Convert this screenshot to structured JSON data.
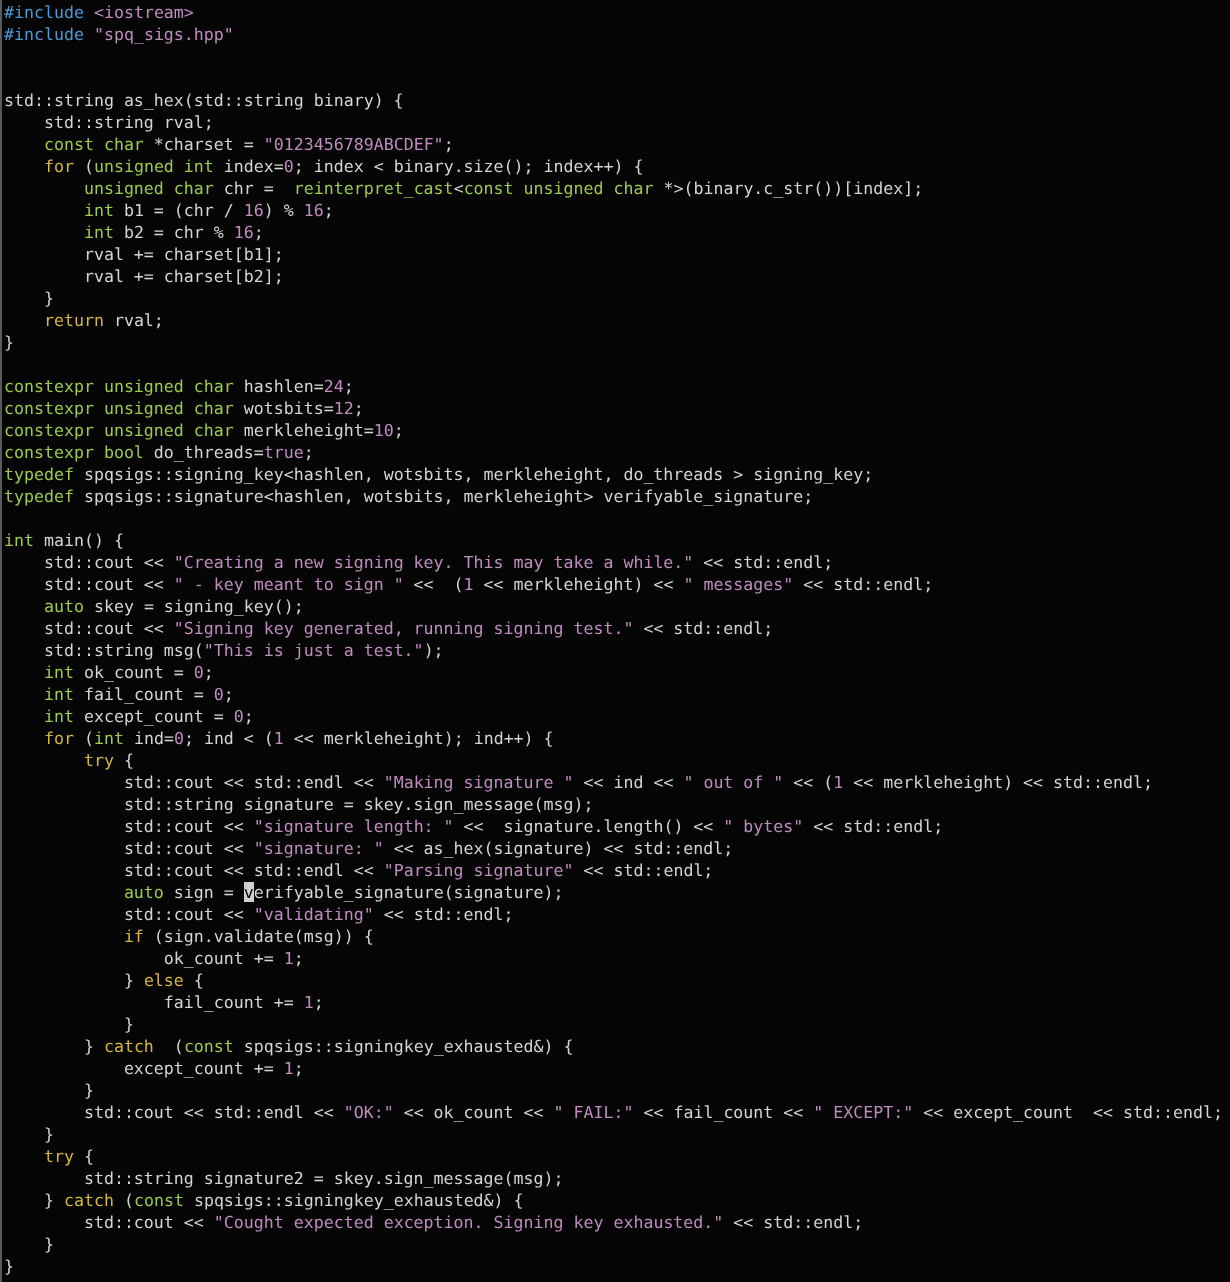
{
  "editor": {
    "lines": [
      {
        "kind": "code",
        "tokens": [
          {
            "kind": "preproc",
            "text": "#include "
          },
          {
            "kind": "string",
            "text": "<iostream>"
          }
        ]
      },
      {
        "kind": "code",
        "tokens": [
          {
            "kind": "preproc",
            "text": "#include "
          },
          {
            "kind": "string",
            "text": "\"spq_sigs.hpp\""
          }
        ]
      },
      {
        "kind": "blank"
      },
      {
        "kind": "blank"
      },
      {
        "kind": "code",
        "tokens": [
          {
            "kind": "plain",
            "text": "std::string as_hex(std::string binary) {"
          }
        ]
      },
      {
        "kind": "code",
        "tokens": [
          {
            "kind": "plain",
            "text": "    std::string rval;"
          }
        ]
      },
      {
        "kind": "code",
        "tokens": [
          {
            "kind": "type",
            "text": "    const char"
          },
          {
            "kind": "plain",
            "text": " *charset = "
          },
          {
            "kind": "string",
            "text": "\"0123456789ABCDEF\""
          },
          {
            "kind": "plain",
            "text": ";"
          }
        ]
      },
      {
        "kind": "code",
        "tokens": [
          {
            "kind": "control",
            "text": "    for"
          },
          {
            "kind": "plain",
            "text": " ("
          },
          {
            "kind": "type",
            "text": "unsigned int"
          },
          {
            "kind": "plain",
            "text": " index="
          },
          {
            "kind": "literal",
            "text": "0"
          },
          {
            "kind": "plain",
            "text": "; index < binary.size(); index++) {"
          }
        ]
      },
      {
        "kind": "code",
        "tokens": [
          {
            "kind": "type",
            "text": "        unsigned char"
          },
          {
            "kind": "plain",
            "text": " chr =  "
          },
          {
            "kind": "type",
            "text": "reinterpret_cast"
          },
          {
            "kind": "plain",
            "text": "<"
          },
          {
            "kind": "type",
            "text": "const unsigned char"
          },
          {
            "kind": "plain",
            "text": " *>(binary.c_str())[index];"
          }
        ]
      },
      {
        "kind": "code",
        "tokens": [
          {
            "kind": "type",
            "text": "        int"
          },
          {
            "kind": "plain",
            "text": " b1 = (chr / "
          },
          {
            "kind": "literal",
            "text": "16"
          },
          {
            "kind": "plain",
            "text": ") % "
          },
          {
            "kind": "literal",
            "text": "16"
          },
          {
            "kind": "plain",
            "text": ";"
          }
        ]
      },
      {
        "kind": "code",
        "tokens": [
          {
            "kind": "type",
            "text": "        int"
          },
          {
            "kind": "plain",
            "text": " b2 = chr % "
          },
          {
            "kind": "literal",
            "text": "16"
          },
          {
            "kind": "plain",
            "text": ";"
          }
        ]
      },
      {
        "kind": "code",
        "tokens": [
          {
            "kind": "plain",
            "text": "        rval += charset[b1];"
          }
        ]
      },
      {
        "kind": "code",
        "tokens": [
          {
            "kind": "plain",
            "text": "        rval += charset[b2];"
          }
        ]
      },
      {
        "kind": "code",
        "tokens": [
          {
            "kind": "plain",
            "text": "    }"
          }
        ]
      },
      {
        "kind": "code",
        "tokens": [
          {
            "kind": "control",
            "text": "    return"
          },
          {
            "kind": "plain",
            "text": " rval;"
          }
        ]
      },
      {
        "kind": "code",
        "tokens": [
          {
            "kind": "plain",
            "text": "}"
          }
        ]
      },
      {
        "kind": "blank"
      },
      {
        "kind": "code",
        "tokens": [
          {
            "kind": "type",
            "text": "constexpr unsigned char"
          },
          {
            "kind": "plain",
            "text": " hashlen="
          },
          {
            "kind": "literal",
            "text": "24"
          },
          {
            "kind": "plain",
            "text": ";"
          }
        ]
      },
      {
        "kind": "code",
        "tokens": [
          {
            "kind": "type",
            "text": "constexpr unsigned char"
          },
          {
            "kind": "plain",
            "text": " wotsbits="
          },
          {
            "kind": "literal",
            "text": "12"
          },
          {
            "kind": "plain",
            "text": ";"
          }
        ]
      },
      {
        "kind": "code",
        "tokens": [
          {
            "kind": "type",
            "text": "constexpr unsigned char"
          },
          {
            "kind": "plain",
            "text": " merkleheight="
          },
          {
            "kind": "literal",
            "text": "10"
          },
          {
            "kind": "plain",
            "text": ";"
          }
        ]
      },
      {
        "kind": "code",
        "tokens": [
          {
            "kind": "type",
            "text": "constexpr bool"
          },
          {
            "kind": "plain",
            "text": " do_threads="
          },
          {
            "kind": "literal",
            "text": "true"
          },
          {
            "kind": "plain",
            "text": ";"
          }
        ]
      },
      {
        "kind": "code",
        "tokens": [
          {
            "kind": "type",
            "text": "typedef"
          },
          {
            "kind": "plain",
            "text": " spqsigs::signing_key<hashlen, wotsbits, merkleheight, do_threads > signing_key;"
          }
        ]
      },
      {
        "kind": "code",
        "tokens": [
          {
            "kind": "type",
            "text": "typedef"
          },
          {
            "kind": "plain",
            "text": " spqsigs::signature<hashlen, wotsbits, merkleheight> verifyable_signature;"
          }
        ]
      },
      {
        "kind": "blank"
      },
      {
        "kind": "code",
        "tokens": [
          {
            "kind": "type",
            "text": "int"
          },
          {
            "kind": "plain",
            "text": " main() {"
          }
        ]
      },
      {
        "kind": "code",
        "tokens": [
          {
            "kind": "plain",
            "text": "    std::cout << "
          },
          {
            "kind": "string",
            "text": "\"Creating a new signing key. This may take a while.\""
          },
          {
            "kind": "plain",
            "text": " << std::endl;"
          }
        ]
      },
      {
        "kind": "code",
        "tokens": [
          {
            "kind": "plain",
            "text": "    std::cout << "
          },
          {
            "kind": "string",
            "text": "\" - key meant to sign \""
          },
          {
            "kind": "plain",
            "text": " <<  ("
          },
          {
            "kind": "literal",
            "text": "1"
          },
          {
            "kind": "plain",
            "text": " << merkleheight) << "
          },
          {
            "kind": "string",
            "text": "\" messages\""
          },
          {
            "kind": "plain",
            "text": " << std::endl;"
          }
        ]
      },
      {
        "kind": "code",
        "tokens": [
          {
            "kind": "type",
            "text": "    auto"
          },
          {
            "kind": "plain",
            "text": " skey = signing_key();"
          }
        ]
      },
      {
        "kind": "code",
        "tokens": [
          {
            "kind": "plain",
            "text": "    std::cout << "
          },
          {
            "kind": "string",
            "text": "\"Signing key generated, running signing test.\""
          },
          {
            "kind": "plain",
            "text": " << std::endl;"
          }
        ]
      },
      {
        "kind": "code",
        "tokens": [
          {
            "kind": "plain",
            "text": "    std::string msg("
          },
          {
            "kind": "string",
            "text": "\"This is just a test.\""
          },
          {
            "kind": "plain",
            "text": ");"
          }
        ]
      },
      {
        "kind": "code",
        "tokens": [
          {
            "kind": "type",
            "text": "    int"
          },
          {
            "kind": "plain",
            "text": " ok_count = "
          },
          {
            "kind": "literal",
            "text": "0"
          },
          {
            "kind": "plain",
            "text": ";"
          }
        ]
      },
      {
        "kind": "code",
        "tokens": [
          {
            "kind": "type",
            "text": "    int"
          },
          {
            "kind": "plain",
            "text": " fail_count = "
          },
          {
            "kind": "literal",
            "text": "0"
          },
          {
            "kind": "plain",
            "text": ";"
          }
        ]
      },
      {
        "kind": "code",
        "tokens": [
          {
            "kind": "type",
            "text": "    int"
          },
          {
            "kind": "plain",
            "text": " except_count = "
          },
          {
            "kind": "literal",
            "text": "0"
          },
          {
            "kind": "plain",
            "text": ";"
          }
        ]
      },
      {
        "kind": "code",
        "tokens": [
          {
            "kind": "control",
            "text": "    for"
          },
          {
            "kind": "plain",
            "text": " ("
          },
          {
            "kind": "type",
            "text": "int"
          },
          {
            "kind": "plain",
            "text": " ind="
          },
          {
            "kind": "literal",
            "text": "0"
          },
          {
            "kind": "plain",
            "text": "; ind < ("
          },
          {
            "kind": "literal",
            "text": "1"
          },
          {
            "kind": "plain",
            "text": " << merkleheight); ind++) {"
          }
        ]
      },
      {
        "kind": "code",
        "tokens": [
          {
            "kind": "control",
            "text": "        try"
          },
          {
            "kind": "plain",
            "text": " {"
          }
        ]
      },
      {
        "kind": "code",
        "tokens": [
          {
            "kind": "plain",
            "text": "            std::cout << std::endl << "
          },
          {
            "kind": "string",
            "text": "\"Making signature \""
          },
          {
            "kind": "plain",
            "text": " << ind << "
          },
          {
            "kind": "string",
            "text": "\" out of \""
          },
          {
            "kind": "plain",
            "text": " << ("
          },
          {
            "kind": "literal",
            "text": "1"
          },
          {
            "kind": "plain",
            "text": " << merkleheight) << std::endl;"
          }
        ]
      },
      {
        "kind": "code",
        "tokens": [
          {
            "kind": "plain",
            "text": "            std::string signature = skey.sign_message(msg);"
          }
        ]
      },
      {
        "kind": "code",
        "tokens": [
          {
            "kind": "plain",
            "text": "            std::cout << "
          },
          {
            "kind": "string",
            "text": "\"signature length: \""
          },
          {
            "kind": "plain",
            "text": " <<  signature.length() << "
          },
          {
            "kind": "string",
            "text": "\" bytes\""
          },
          {
            "kind": "plain",
            "text": " << std::endl;"
          }
        ]
      },
      {
        "kind": "code",
        "tokens": [
          {
            "kind": "plain",
            "text": "            std::cout << "
          },
          {
            "kind": "string",
            "text": "\"signature: \""
          },
          {
            "kind": "plain",
            "text": " << as_hex(signature) << std::endl;"
          }
        ]
      },
      {
        "kind": "code",
        "tokens": [
          {
            "kind": "plain",
            "text": "            std::cout << std::endl << "
          },
          {
            "kind": "string",
            "text": "\"Parsing signature\""
          },
          {
            "kind": "plain",
            "text": " << std::endl;"
          }
        ]
      },
      {
        "kind": "code",
        "tokens": [
          {
            "kind": "type",
            "text": "            auto"
          },
          {
            "kind": "plain",
            "text": " sign = "
          },
          {
            "kind": "plain",
            "text": "v",
            "cursor": true
          },
          {
            "kind": "plain",
            "text": "erifyable_signature(signature);"
          }
        ]
      },
      {
        "kind": "code",
        "tokens": [
          {
            "kind": "plain",
            "text": "            std::cout << "
          },
          {
            "kind": "string",
            "text": "\"validating\""
          },
          {
            "kind": "plain",
            "text": " << std::endl;"
          }
        ]
      },
      {
        "kind": "code",
        "tokens": [
          {
            "kind": "control",
            "text": "            if"
          },
          {
            "kind": "plain",
            "text": " (sign.validate(msg)) {"
          }
        ]
      },
      {
        "kind": "code",
        "tokens": [
          {
            "kind": "plain",
            "text": "                ok_count += "
          },
          {
            "kind": "literal",
            "text": "1"
          },
          {
            "kind": "plain",
            "text": ";"
          }
        ]
      },
      {
        "kind": "code",
        "tokens": [
          {
            "kind": "plain",
            "text": "            } "
          },
          {
            "kind": "control",
            "text": "else"
          },
          {
            "kind": "plain",
            "text": " {"
          }
        ]
      },
      {
        "kind": "code",
        "tokens": [
          {
            "kind": "plain",
            "text": "                fail_count += "
          },
          {
            "kind": "literal",
            "text": "1"
          },
          {
            "kind": "plain",
            "text": ";"
          }
        ]
      },
      {
        "kind": "code",
        "tokens": [
          {
            "kind": "plain",
            "text": "            }"
          }
        ]
      },
      {
        "kind": "code",
        "tokens": [
          {
            "kind": "plain",
            "text": "        } "
          },
          {
            "kind": "control",
            "text": "catch"
          },
          {
            "kind": "plain",
            "text": "  ("
          },
          {
            "kind": "type",
            "text": "const"
          },
          {
            "kind": "plain",
            "text": " spqsigs::signingkey_exhausted&) {"
          }
        ]
      },
      {
        "kind": "code",
        "tokens": [
          {
            "kind": "plain",
            "text": "            except_count += "
          },
          {
            "kind": "literal",
            "text": "1"
          },
          {
            "kind": "plain",
            "text": ";"
          }
        ]
      },
      {
        "kind": "code",
        "tokens": [
          {
            "kind": "plain",
            "text": "        }"
          }
        ]
      },
      {
        "kind": "code",
        "tokens": [
          {
            "kind": "plain",
            "text": "        std::cout << std::endl << "
          },
          {
            "kind": "string",
            "text": "\"OK:\""
          },
          {
            "kind": "plain",
            "text": " << ok_count << "
          },
          {
            "kind": "string",
            "text": "\" FAIL:\""
          },
          {
            "kind": "plain",
            "text": " << fail_count << "
          },
          {
            "kind": "string",
            "text": "\" EXCEPT:\""
          },
          {
            "kind": "plain",
            "text": " << except_count  << std::endl;"
          }
        ]
      },
      {
        "kind": "code",
        "tokens": [
          {
            "kind": "plain",
            "text": "    }"
          }
        ]
      },
      {
        "kind": "code",
        "tokens": [
          {
            "kind": "control",
            "text": "    try"
          },
          {
            "kind": "plain",
            "text": " {"
          }
        ]
      },
      {
        "kind": "code",
        "tokens": [
          {
            "kind": "plain",
            "text": "        std::string signature2 = skey.sign_message(msg);"
          }
        ]
      },
      {
        "kind": "code",
        "tokens": [
          {
            "kind": "plain",
            "text": "    } "
          },
          {
            "kind": "control",
            "text": "catch"
          },
          {
            "kind": "plain",
            "text": " ("
          },
          {
            "kind": "type",
            "text": "const"
          },
          {
            "kind": "plain",
            "text": " spqsigs::signingkey_exhausted&) {"
          }
        ]
      },
      {
        "kind": "code",
        "tokens": [
          {
            "kind": "plain",
            "text": "        std::cout << "
          },
          {
            "kind": "string",
            "text": "\"Cought expected exception. Signing key exhausted.\""
          },
          {
            "kind": "plain",
            "text": " << std::endl;"
          }
        ]
      },
      {
        "kind": "code",
        "tokens": [
          {
            "kind": "plain",
            "text": "    }"
          }
        ]
      },
      {
        "kind": "code",
        "tokens": [
          {
            "kind": "plain",
            "text": "}"
          }
        ]
      }
    ]
  }
}
